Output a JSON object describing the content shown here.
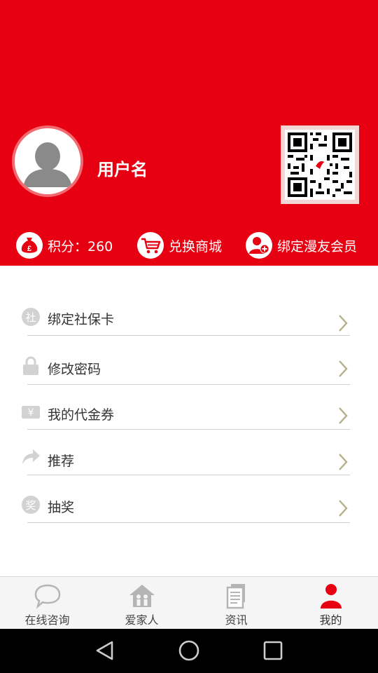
{
  "profile": {
    "username": "用户名"
  },
  "stats": {
    "points_label": "积分：260",
    "mall_label": "兑换商城",
    "member_label": "绑定漫友会员"
  },
  "menu": [
    {
      "label": "绑定社保卡",
      "icon": "social-security-icon",
      "icon_text": "社"
    },
    {
      "label": "修改密码",
      "icon": "lock-icon"
    },
    {
      "label": "我的代金券",
      "icon": "voucher-icon",
      "icon_text": "¥"
    },
    {
      "label": "推荐",
      "icon": "share-arrow-icon"
    },
    {
      "label": "抽奖",
      "icon": "lottery-icon",
      "icon_text": "奖"
    }
  ],
  "bottom_nav": [
    {
      "label": "在线咨询",
      "icon": "chat-bubble-icon"
    },
    {
      "label": "爱家人",
      "icon": "family-house-icon"
    },
    {
      "label": "资讯",
      "icon": "news-document-icon"
    },
    {
      "label": "我的",
      "icon": "person-icon",
      "active": true
    }
  ],
  "colors": {
    "brand_red": "#e60012",
    "active_tab": "#e60012",
    "inactive_icon": "#b5b5b5"
  }
}
